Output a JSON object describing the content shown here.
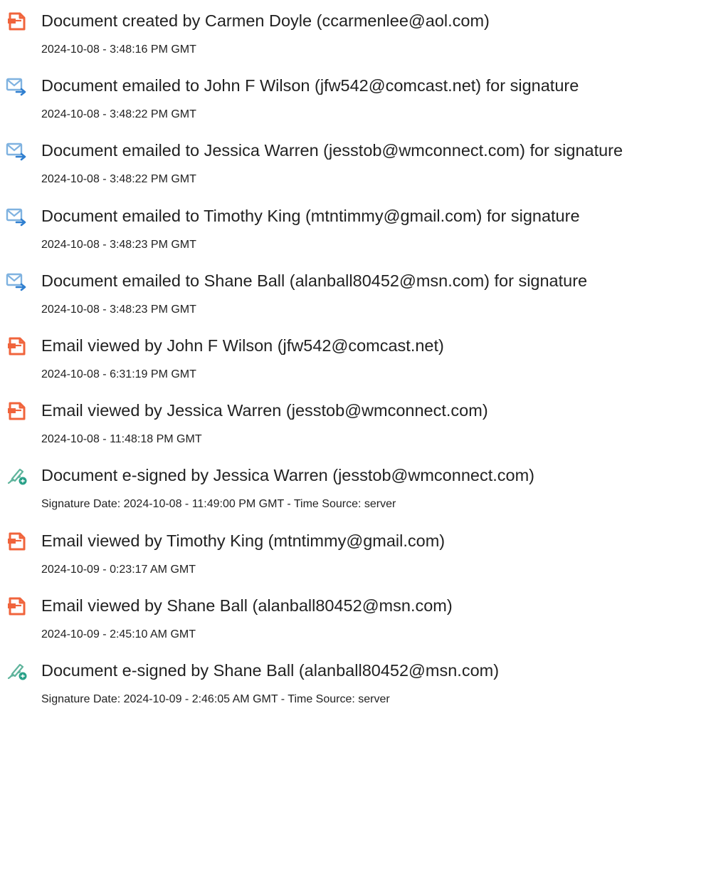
{
  "entries": [
    {
      "type": "created",
      "icon": "document-created-icon",
      "title": "Document created by Carmen Doyle (ccarmenlee@aol.com)",
      "detail": "2024-10-08 - 3:48:16 PM GMT"
    },
    {
      "type": "emailed",
      "icon": "email-sent-icon",
      "title": "Document emailed to John F Wilson (jfw542@comcast.net) for signature",
      "detail": "2024-10-08 - 3:48:22 PM GMT"
    },
    {
      "type": "emailed",
      "icon": "email-sent-icon",
      "title": "Document emailed to Jessica Warren (jesstob@wmconnect.com) for signature",
      "detail": "2024-10-08 - 3:48:22 PM GMT"
    },
    {
      "type": "emailed",
      "icon": "email-sent-icon",
      "title": "Document emailed to Timothy King (mtntimmy@gmail.com) for signature",
      "detail": "2024-10-08 - 3:48:23 PM GMT"
    },
    {
      "type": "emailed",
      "icon": "email-sent-icon",
      "title": "Document emailed to Shane Ball (alanball80452@msn.com) for signature",
      "detail": "2024-10-08 - 3:48:23 PM GMT"
    },
    {
      "type": "viewed",
      "icon": "email-viewed-icon",
      "title": "Email viewed by John F Wilson (jfw542@comcast.net)",
      "detail": "2024-10-08 - 6:31:19 PM GMT"
    },
    {
      "type": "viewed",
      "icon": "email-viewed-icon",
      "title": "Email viewed by Jessica Warren (jesstob@wmconnect.com)",
      "detail": "2024-10-08 - 11:48:18 PM GMT"
    },
    {
      "type": "signed",
      "icon": "e-signature-pen-icon",
      "title": "Document e-signed by Jessica Warren (jesstob@wmconnect.com)",
      "detail": "Signature Date: 2024-10-08 - 11:49:00 PM GMT - Time Source: server"
    },
    {
      "type": "viewed",
      "icon": "email-viewed-icon",
      "title": "Email viewed by Timothy King (mtntimmy@gmail.com)",
      "detail": "2024-10-09 - 0:23:17 AM GMT"
    },
    {
      "type": "viewed",
      "icon": "email-viewed-icon",
      "title": "Email viewed by Shane Ball (alanball80452@msn.com)",
      "detail": "2024-10-09 - 2:45:10 AM GMT"
    },
    {
      "type": "signed",
      "icon": "e-signature-pen-icon",
      "title": "Document e-signed by Shane Ball (alanball80452@msn.com)",
      "detail": "Signature Date: 2024-10-09 - 2:46:05 AM GMT - Time Source: server"
    }
  ],
  "colors": {
    "text": "#222222",
    "doc_icon": "#f0643c",
    "mail_icon": "#7fb2e0",
    "mail_arrow": "#2f7fd0",
    "pen_icon": "#5fb49c",
    "pen_badge": "#2aa189"
  }
}
